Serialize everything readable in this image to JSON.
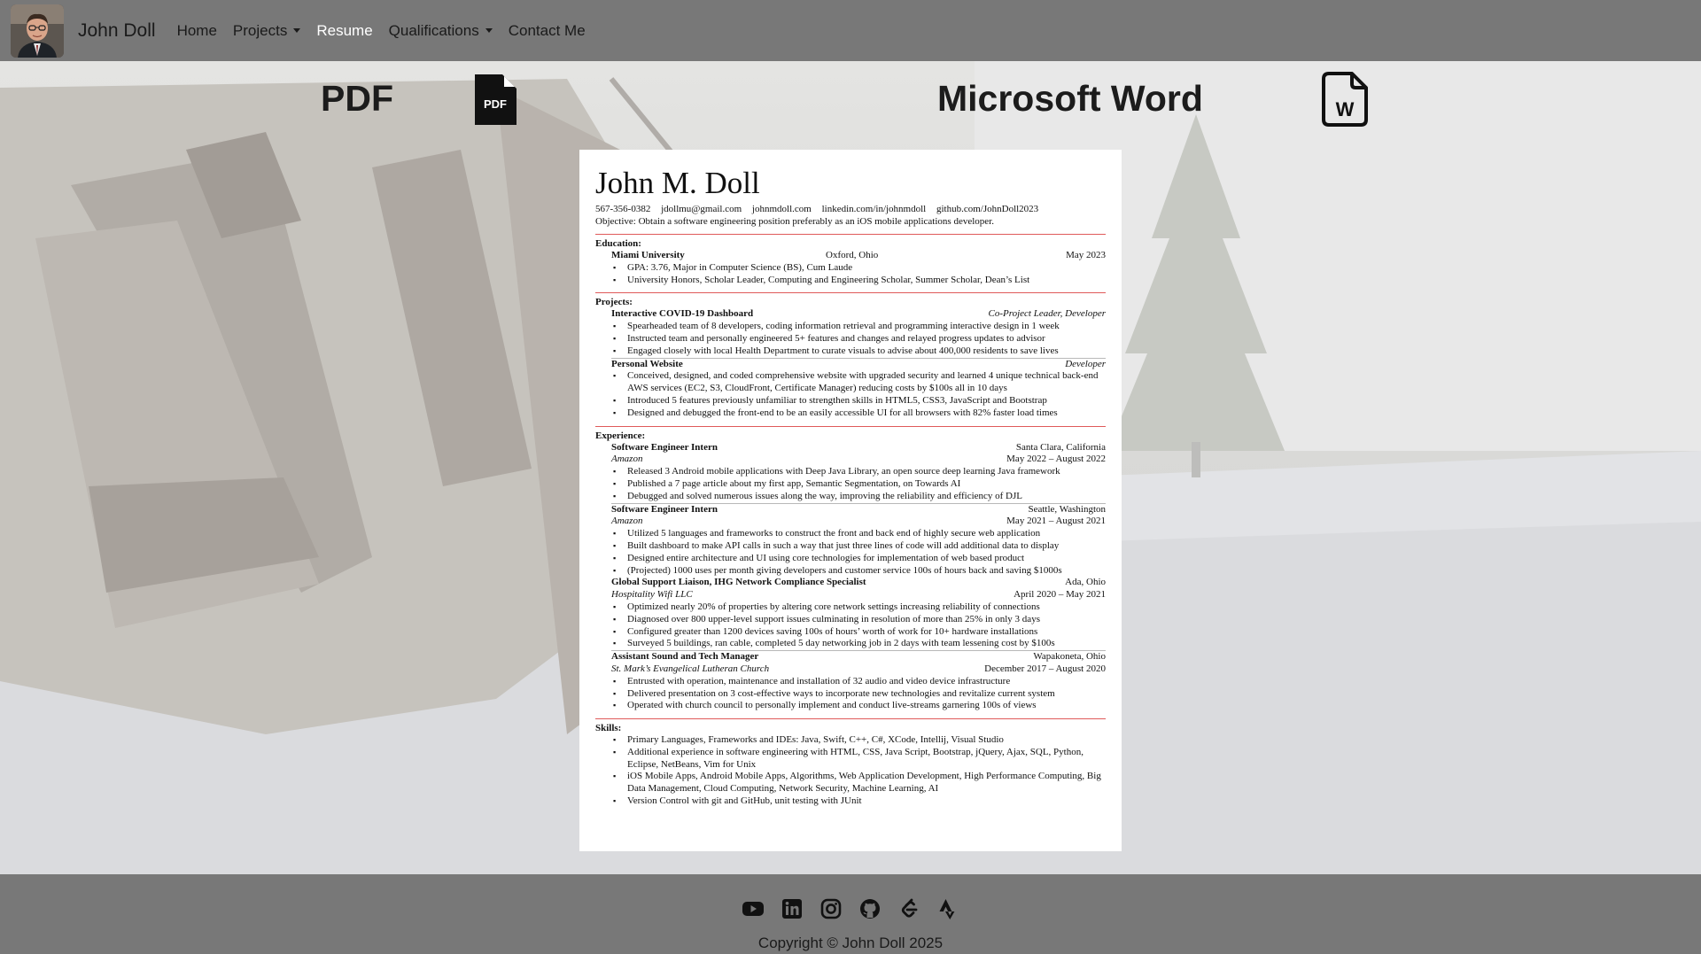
{
  "navbar": {
    "brand": "John Doll",
    "items": [
      {
        "label": "Home",
        "dropdown": false,
        "active": false
      },
      {
        "label": "Projects",
        "dropdown": true,
        "active": false
      },
      {
        "label": "Resume",
        "dropdown": false,
        "active": true
      },
      {
        "label": "Qualifications",
        "dropdown": true,
        "active": false
      },
      {
        "label": "Contact Me",
        "dropdown": false,
        "active": false
      }
    ]
  },
  "downloads": {
    "pdf_label": "PDF",
    "pdf_icon": "pdf-file-icon",
    "pdf_icon_text": "PDF",
    "word_label": "Microsoft Word",
    "word_icon": "word-file-icon",
    "word_icon_text": "W"
  },
  "resume": {
    "name": "John M. Doll",
    "contact": [
      "567-356-0382",
      "jdollmu@gmail.com",
      "johnmdoll.com",
      "linkedin.com/in/johnmdoll",
      "github.com/JohnDoll2023"
    ],
    "objective": "Objective: Obtain a software engineering position preferably as an iOS mobile applications developer.",
    "education": {
      "heading": "Education:",
      "school": "Miami University",
      "location": "Oxford, Ohio",
      "date": "May 2023",
      "bullets": [
        "GPA: 3.76, Major in Computer Science (BS), Cum Laude",
        "University Honors, Scholar Leader, Computing and Engineering Scholar, Summer Scholar, Dean’s List"
      ]
    },
    "projects": {
      "heading": "Projects:",
      "items": [
        {
          "title": "Interactive COVID-19 Dashboard",
          "role": "Co-Project Leader, Developer",
          "bullets": [
            "Spearheaded team of 8 developers, coding information retrieval and programming interactive design in 1 week",
            "Instructed team and personally engineered 5+ features and changes and relayed progress updates to advisor",
            "Engaged closely with local Health Department to curate visuals to advise about 400,000 residents to save lives"
          ]
        },
        {
          "title": "Personal Website",
          "role": "Developer",
          "bullets": [
            "Conceived, designed, and coded comprehensive website with upgraded security and learned 4 unique technical back-end AWS services (EC2, S3, CloudFront, Certificate Manager) reducing costs by $100s all in 10 days",
            "Introduced 5 features previously unfamiliar to strengthen skills in HTML5, CSS3, JavaScript and Bootstrap",
            "Designed and debugged the front-end to be an easily accessible UI for all browsers with 82% faster load times"
          ]
        }
      ]
    },
    "experience": {
      "heading": "Experience:",
      "items": [
        {
          "title": "Software Engineer Intern",
          "location": "Santa Clara, California",
          "company": "Amazon",
          "dates": "May 2022 – August 2022",
          "bullets": [
            "Released 3 Android mobile applications with Deep Java Library, an open source deep learning Java framework",
            "Published a 7 page article about my first app, Semantic Segmentation, on Towards AI",
            "Debugged and solved numerous issues along the way, improving the reliability and efficiency of DJL"
          ]
        },
        {
          "title": "Software Engineer Intern",
          "location": "Seattle, Washington",
          "company": "Amazon",
          "dates": "May 2021 – August 2021",
          "bullets": [
            "Utilized 5 languages and frameworks to construct the front and back end of highly secure web application",
            "Built dashboard to make API calls in such a way that just three lines of code will add additional data to display",
            "Designed entire architecture and UI using core technologies for implementation of web based product",
            "(Projected) 1000 uses per month giving developers and customer service 100s of hours back and saving $1000s"
          ]
        },
        {
          "title": "Global Support Liaison, IHG Network Compliance Specialist",
          "location": "Ada, Ohio",
          "company": "Hospitality Wifi LLC",
          "dates": "April 2020 – May 2021",
          "bullets": [
            "Optimized nearly 20% of properties by altering core network settings increasing reliability of connections",
            "Diagnosed over 800 upper-level support issues culminating in resolution of more than 25% in only 3 days",
            "Configured greater than 1200 devices saving 100s of hours’ worth of work for 10+ hardware installations",
            "Surveyed 5 buildings, ran cable, completed 5 day networking job in 2 days with team lessening cost by $100s"
          ]
        },
        {
          "title": "Assistant Sound and Tech Manager",
          "location": "Wapakoneta, Ohio",
          "company": "St. Mark’s Evangelical Lutheran Church",
          "dates": "December 2017 – August 2020",
          "bullets": [
            "Entrusted with operation, maintenance and installation of 32 audio and video device infrastructure",
            "Delivered presentation on 3 cost-effective ways to incorporate new technologies and revitalize current system",
            "Operated with church council to personally implement and conduct live-streams garnering 100s of views"
          ]
        }
      ]
    },
    "skills": {
      "heading": "Skills:",
      "bullets": [
        "Primary Languages, Frameworks and IDEs: Java, Swift, C++, C#, XCode, Intellij, Visual Studio",
        "Additional experience in software engineering with HTML, CSS, Java Script, Bootstrap, jQuery, Ajax, SQL, Python, Eclipse, NetBeans, Vim for Unix",
        "iOS Mobile Apps, Android Mobile Apps, Algorithms, Web Application Development, High Performance Computing, Big Data Management, Cloud Computing, Network Security, Machine Learning, AI",
        "Version Control with git and GitHub, unit testing with JUnit"
      ]
    }
  },
  "footer": {
    "social_icons": [
      "youtube-icon",
      "linkedin-icon",
      "instagram-icon",
      "github-icon",
      "leetcode-icon",
      "strava-icon"
    ],
    "copyright": "Copyright © John Doll 2025"
  }
}
